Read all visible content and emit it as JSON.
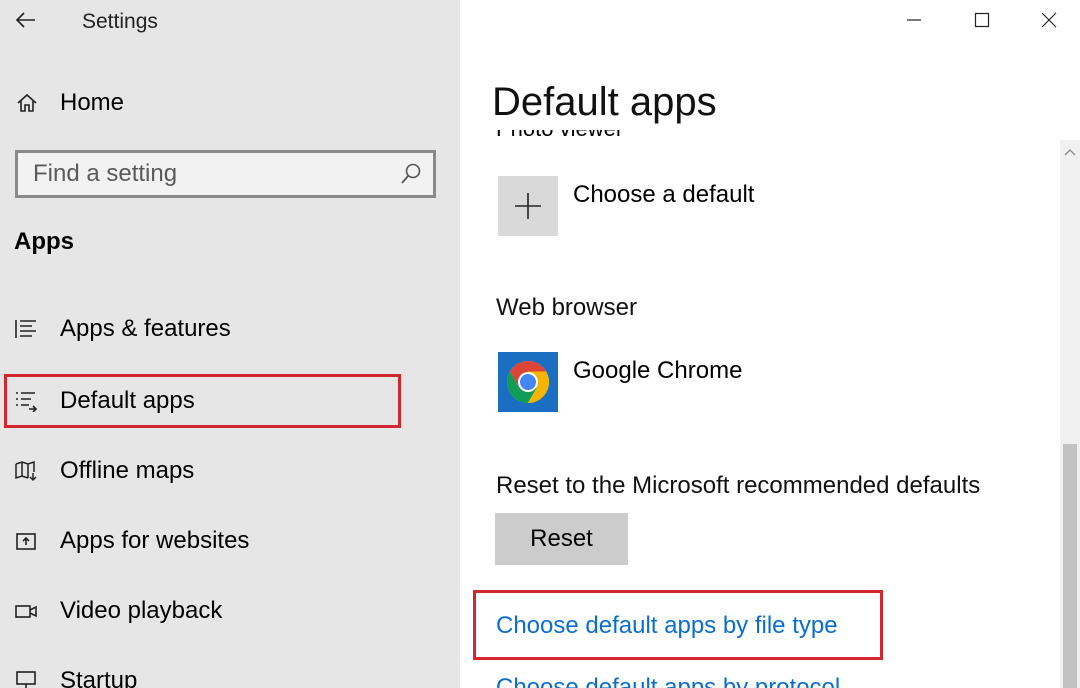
{
  "window": {
    "title": "Settings",
    "icons": {
      "back": "back-arrow-icon",
      "minimize": "minimize-icon",
      "maximize": "maximize-icon",
      "close": "close-icon"
    }
  },
  "sidebar": {
    "home_label": "Home",
    "search_placeholder": "Find a setting",
    "section_title": "Apps",
    "items": [
      {
        "label": "Apps & features",
        "icon": "apps-features-icon",
        "selected": false
      },
      {
        "label": "Default apps",
        "icon": "default-apps-icon",
        "selected": true
      },
      {
        "label": "Offline maps",
        "icon": "offline-maps-icon",
        "selected": false
      },
      {
        "label": "Apps for websites",
        "icon": "apps-for-websites-icon",
        "selected": false
      },
      {
        "label": "Video playback",
        "icon": "video-playback-icon",
        "selected": false
      },
      {
        "label": "Startup",
        "icon": "startup-icon",
        "selected": false
      }
    ]
  },
  "main": {
    "title": "Default apps",
    "clipped_text": "Photo viewer",
    "photo_viewer_choice": "Choose a default",
    "web_browser_label": "Web browser",
    "web_browser_value": "Google Chrome",
    "reset_label": "Reset to the Microsoft recommended defaults",
    "reset_button": "Reset",
    "links": {
      "by_file_type": "Choose default apps by file type",
      "by_protocol": "Choose default apps by protocol"
    }
  },
  "colors": {
    "sidebar_bg": "#e6e6e6",
    "link": "#0a6ed1",
    "highlight": "#d22630",
    "chrome_tile": "#1b6fc2"
  }
}
